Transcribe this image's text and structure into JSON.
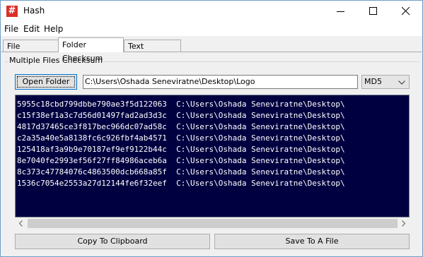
{
  "window": {
    "title": "Hash",
    "app_icon_glyph": "#",
    "controls": [
      "minimize-icon",
      "maximize-icon",
      "close-icon"
    ]
  },
  "menu": [
    "File",
    "Edit",
    "Help"
  ],
  "tabs": [
    {
      "label": "File Checksum",
      "active": false
    },
    {
      "label": "Folder Checksum",
      "active": true
    },
    {
      "label": "Text Checksum",
      "active": false
    }
  ],
  "group": {
    "label": "Multiple Files Checksum"
  },
  "controls": {
    "open_folder_label": "Open Folder",
    "folder_path": "C:\\Users\\Oshada Seneviratne\\Desktop\\Logo",
    "algorithm": "MD5"
  },
  "results": [
    {
      "hash": "5955c18cbd799dbbe790ae3f5d122063",
      "path": "C:\\Users\\Oshada Seneviratne\\Desktop\\"
    },
    {
      "hash": "c15f38ef1a3c7d56d01497fad2ad3d3c",
      "path": "C:\\Users\\Oshada Seneviratne\\Desktop\\"
    },
    {
      "hash": "4817d37465ce3f817bec966dc07ad58c",
      "path": "C:\\Users\\Oshada Seneviratne\\Desktop\\"
    },
    {
      "hash": "c2a35a40e5a8138fc6c926fbf4ab4571",
      "path": "C:\\Users\\Oshada Seneviratne\\Desktop\\"
    },
    {
      "hash": "125418af3a9b9e70187ef9ef9122b44c",
      "path": "C:\\Users\\Oshada Seneviratne\\Desktop\\"
    },
    {
      "hash": "8e7040fe2993ef56f27ff84986aceb6a",
      "path": "C:\\Users\\Oshada Seneviratne\\Desktop\\"
    },
    {
      "hash": "8c373c47784076c4863500dcb668a85f",
      "path": "C:\\Users\\Oshada Seneviratne\\Desktop\\"
    },
    {
      "hash": "1536c7054e2553a27d12144fe6f32eef",
      "path": "C:\\Users\\Oshada Seneviratne\\Desktop\\"
    }
  ],
  "buttons": {
    "copy_label": "Copy To Clipboard",
    "save_label": "Save To A File"
  },
  "colors": {
    "output_bg": "#000040",
    "output_text": "#ffffff",
    "focus_border": "#0078d7",
    "app_icon_bg": "#d9302a"
  }
}
